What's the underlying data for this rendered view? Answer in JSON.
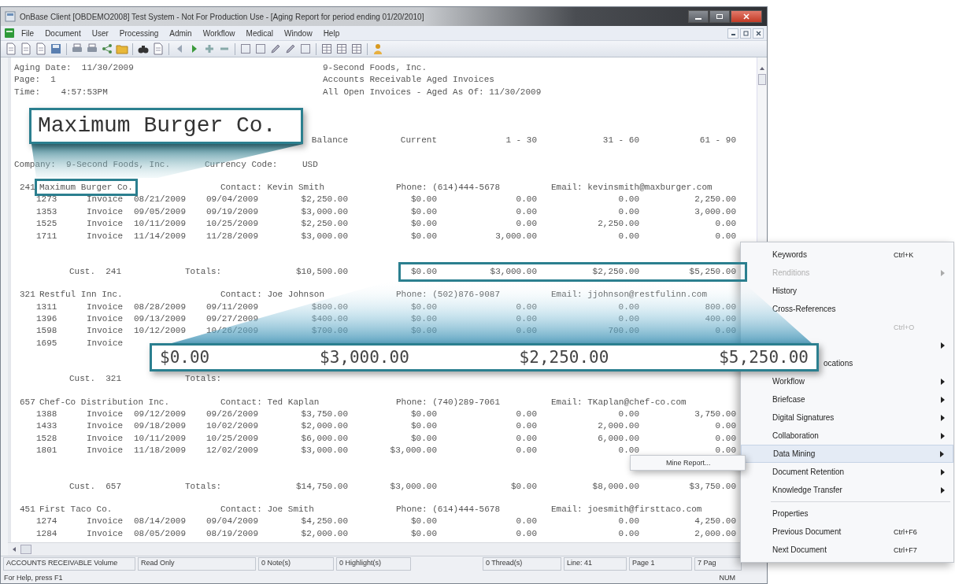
{
  "window": {
    "title": "OnBase Client [OBDEMO2008] Test System - Not For Production Use - [Aging Report for period ending 01/20/2010]"
  },
  "menu_bar": [
    "File",
    "Document",
    "User",
    "Processing",
    "Admin",
    "Workflow",
    "Medical",
    "Window",
    "Help"
  ],
  "report": {
    "header_lines": [
      {
        "left": "Aging Date:  11/30/2009",
        "center": "9-Second Foods, Inc."
      },
      {
        "left": "Page:  1",
        "center": "Accounts Receivable Aged Invoices"
      },
      {
        "left": "Time:    4:57:53PM",
        "center": "All Open Invoices - Aged As Of: 11/30/2009"
      }
    ],
    "columns": [
      "Balance",
      "Current",
      "1 - 30",
      "31 - 60",
      "61 - 90"
    ],
    "company": {
      "label": "Company:",
      "value": "9-Second Foods, Inc.",
      "currency_label": "Currency Code:",
      "currency": "USD"
    },
    "customers": [
      {
        "number": "241",
        "name": "Maximum Burger Co.",
        "contact": "Contact: Kevin Smith",
        "phone": "Phone: (614)444-5678",
        "email": "Email: kevinsmith@maxburger.com",
        "highlighted": true,
        "invoices": [
          {
            "cells": [
              "1273",
              "Invoice",
              "08/21/2009",
              "09/04/2009",
              "$2,250.00",
              "$0.00",
              "0.00",
              "0.00",
              "2,250.00"
            ]
          },
          {
            "cells": [
              "1353",
              "Invoice",
              "09/05/2009",
              "09/19/2009",
              "$3,000.00",
              "$0.00",
              "0.00",
              "0.00",
              "3,000.00"
            ]
          },
          {
            "cells": [
              "1525",
              "Invoice",
              "10/11/2009",
              "10/25/2009",
              "$2,250.00",
              "$0.00",
              "0.00",
              "2,250.00",
              "0.00"
            ]
          },
          {
            "cells": [
              "1711",
              "Invoice",
              "11/14/2009",
              "11/28/2009",
              "$3,000.00",
              "$0.00",
              "3,000.00",
              "0.00",
              "0.00"
            ]
          }
        ],
        "totals": {
          "label": "Cust.  241",
          "title": "Totals:",
          "amounts": [
            "$10,500.00",
            "$0.00",
            "$3,000.00",
            "$2,250.00",
            "$5,250.00"
          ],
          "highlighted": true
        }
      },
      {
        "number": "321",
        "name": "Restful Inn Inc.",
        "contact": "Contact: Joe Johnson",
        "phone": "Phone: (502)876-9087",
        "email": "Email: jjohnson@restfulinn.com",
        "highlighted": false,
        "invoices": [
          {
            "cells": [
              "1311",
              "Invoice",
              "08/28/2009",
              "09/11/2009",
              "$800.00",
              "$0.00",
              "0.00",
              "0.00",
              "800.00"
            ]
          },
          {
            "cells": [
              "1396",
              "Invoice",
              "09/13/2009",
              "09/27/2009",
              "$400.00",
              "$0.00",
              "0.00",
              "0.00",
              "400.00"
            ]
          },
          {
            "cells": [
              "1598",
              "Invoice",
              "10/12/2009",
              "10/26/2009",
              "$700.00",
              "$0.00",
              "0.00",
              "700.00",
              "0.00"
            ]
          },
          {
            "cells": [
              "1695",
              "Invoice"
            ]
          }
        ],
        "totals": {
          "label": "Cust.  321",
          "title": "Totals:",
          "highlighted": false
        }
      },
      {
        "number": "657",
        "name": "Chef-Co Distribution Inc.",
        "contact": "Contact: Ted Kaplan",
        "phone": "Phone: (740)289-7061",
        "email": "Email: TKaplan@chef-co.com",
        "highlighted": false,
        "invoices": [
          {
            "cells": [
              "1388",
              "Invoice",
              "09/12/2009",
              "09/26/2009",
              "$3,750.00",
              "$0.00",
              "0.00",
              "0.00",
              "3,750.00"
            ]
          },
          {
            "cells": [
              "1433",
              "Invoice",
              "09/18/2009",
              "10/02/2009",
              "$2,000.00",
              "$0.00",
              "0.00",
              "2,000.00",
              "0.00"
            ]
          },
          {
            "cells": [
              "1528",
              "Invoice",
              "10/11/2009",
              "10/25/2009",
              "$6,000.00",
              "$0.00",
              "0.00",
              "6,000.00",
              "0.00"
            ]
          },
          {
            "cells": [
              "1801",
              "Invoice",
              "11/18/2009",
              "12/02/2009",
              "$3,000.00",
              "$3,000.00",
              "0.00",
              "0.00",
              "0.00"
            ]
          }
        ],
        "totals": {
          "label": "Cust.  657",
          "title": "Totals:",
          "amounts": [
            "$14,750.00",
            "$3,000.00",
            "$0.00",
            "$8,000.00",
            "$3,750.00"
          ],
          "highlighted": false
        }
      },
      {
        "number": "451",
        "name": "First Taco Co.",
        "contact": "Contact: Joe Smith",
        "phone": "Phone: (614)444-5678",
        "email": "Email: joesmith@firsttaco.com",
        "highlighted": false,
        "invoices": [
          {
            "cells": [
              "1274",
              "Invoice",
              "08/14/2009",
              "09/04/2009",
              "$4,250.00",
              "$0.00",
              "0.00",
              "0.00",
              "4,250.00"
            ]
          },
          {
            "cells": [
              "1284",
              "Invoice",
              "08/05/2009",
              "08/19/2009",
              "$2,000.00",
              "$0.00",
              "0.00",
              "0.00",
              "2,000.00"
            ]
          }
        ]
      }
    ]
  },
  "callouts": [
    {
      "kind": "name",
      "text": "Maximum Burger Co."
    },
    {
      "kind": "amounts",
      "values": [
        "$0.00",
        "$3,000.00",
        "$2,250.00",
        "$5,250.00"
      ]
    }
  ],
  "context_menu": [
    {
      "kind": "item",
      "label": "Keywords",
      "shortcut": "Ctrl+K",
      "submenu": false,
      "disabled": false,
      "selected": false
    },
    {
      "kind": "item",
      "label": "Renditions",
      "submenu": true,
      "disabled": true,
      "selected": false
    },
    {
      "kind": "item",
      "label": "History",
      "submenu": false,
      "disabled": false,
      "selected": false
    },
    {
      "kind": "item",
      "label": "Cross-References",
      "submenu": false,
      "disabled": false,
      "selected": false
    },
    {
      "kind": "item",
      "shortcut": "Ctrl+O",
      "submenu": false,
      "disabled": true,
      "selected": false
    },
    {
      "kind": "item",
      "submenu": true,
      "disabled": false,
      "selected": false
    },
    {
      "kind": "partial",
      "label": "ocations",
      "submenu": false,
      "disabled": false,
      "selected": false
    },
    {
      "kind": "item",
      "label": "Workflow",
      "submenu": true,
      "disabled": false,
      "selected": false
    },
    {
      "kind": "item",
      "label": "Briefcase",
      "submenu": true,
      "disabled": false,
      "selected": false
    },
    {
      "kind": "item",
      "label": "Digital Signatures",
      "submenu": true,
      "disabled": false,
      "selected": false
    },
    {
      "kind": "item",
      "label": "Collaboration",
      "submenu": true,
      "disabled": false,
      "selected": false
    },
    {
      "kind": "item",
      "label": "Data Mining",
      "submenu": true,
      "disabled": false,
      "selected": true
    },
    {
      "kind": "item",
      "label": "Document Retention",
      "submenu": true,
      "disabled": false,
      "selected": false
    },
    {
      "kind": "item",
      "label": "Knowledge Transfer",
      "submenu": true,
      "disabled": false,
      "selected": false
    },
    {
      "kind": "separator"
    },
    {
      "kind": "item",
      "label": "Properties",
      "submenu": false,
      "disabled": false,
      "selected": false
    },
    {
      "kind": "item",
      "label": "Previous Document",
      "shortcut": "Ctrl+F6",
      "submenu": false,
      "disabled": false,
      "selected": false
    },
    {
      "kind": "item",
      "label": "Next Document",
      "shortcut": "Ctrl+F7",
      "submenu": false,
      "disabled": false,
      "selected": false
    }
  ],
  "submenu": [
    "Mine Report..."
  ],
  "status_bar": [
    "ACCOUNTS RECEIVABLE Volume",
    "Read Only",
    "0 Note(s)",
    "0 Highlight(s)",
    "0 Thread(s)",
    "Line: 41",
    "Page 1",
    "7 Pag"
  ],
  "help_line": {
    "text": "For Help, press F1",
    "indicator": "NUM"
  }
}
